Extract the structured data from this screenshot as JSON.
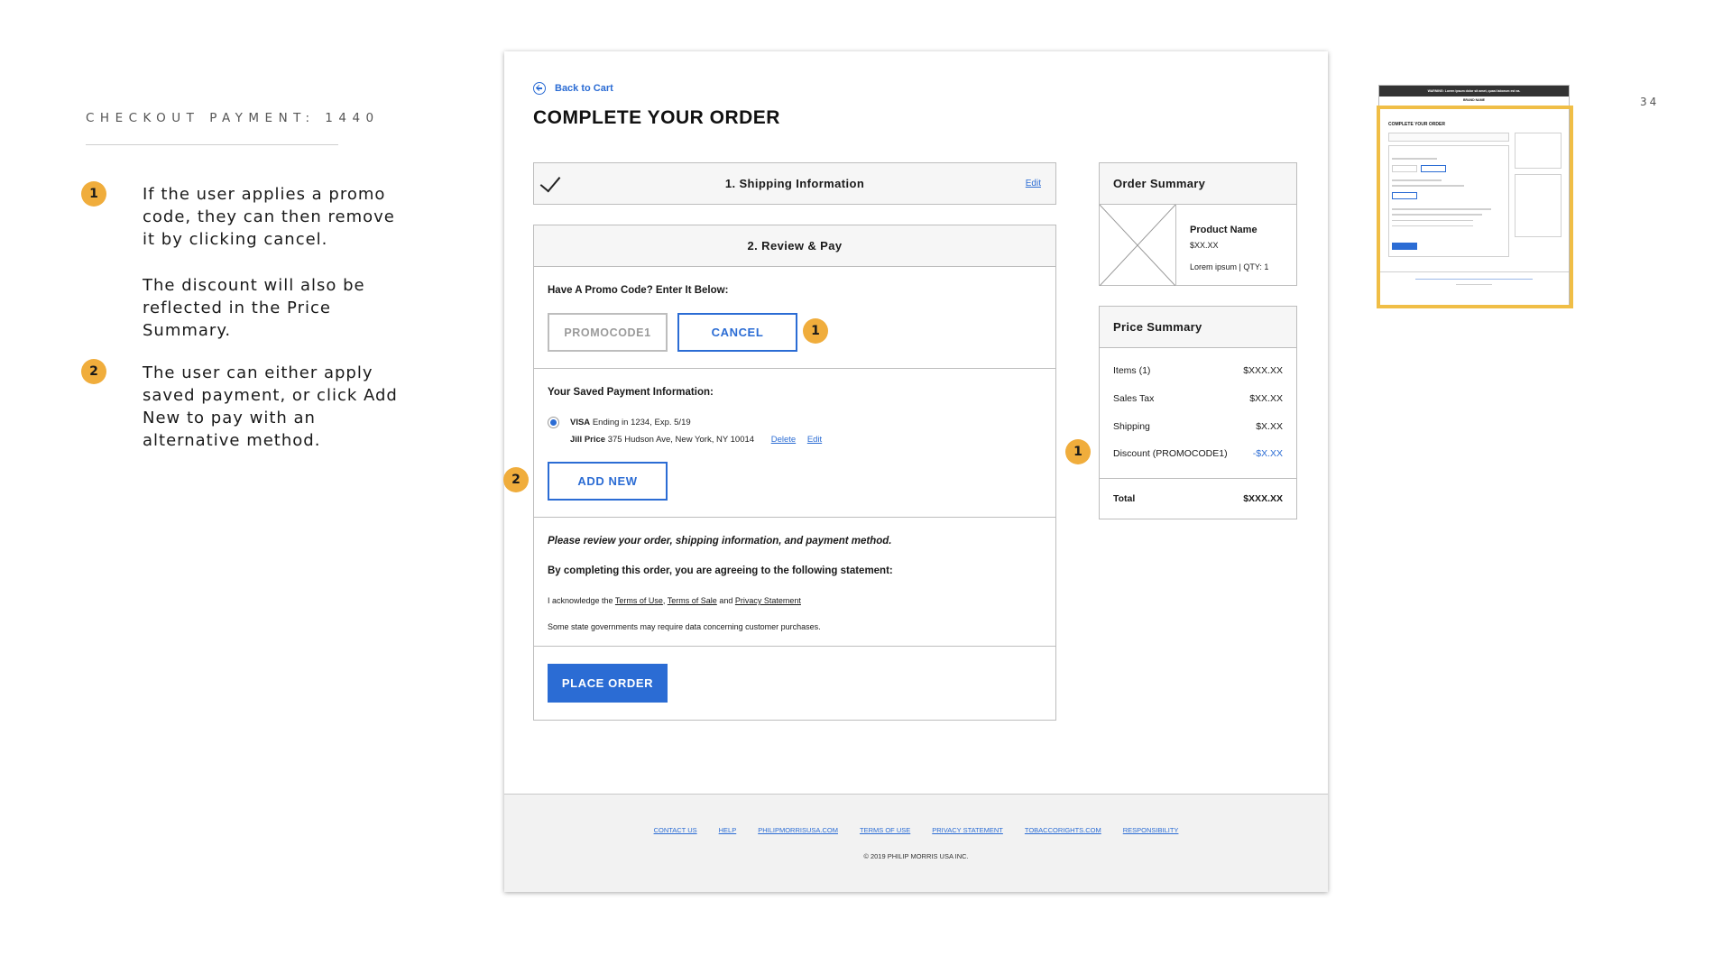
{
  "slide": {
    "title": "CHECKOUT PAYMENT: 1440",
    "page_number": "34",
    "notes": [
      {
        "badge": "1",
        "paragraphs": [
          "If the user applies a promo code, they can then remove it by clicking cancel.",
          "The discount will also be reflected in the Price Summary."
        ]
      },
      {
        "badge": "2",
        "paragraphs": [
          "The user can either apply saved payment, or click Add New to pay with an alternative method."
        ]
      }
    ]
  },
  "page": {
    "back_link": "Back to Cart",
    "title": "COMPLETE YOUR ORDER",
    "shipping": {
      "label": "1. Shipping Information",
      "edit": "Edit"
    },
    "review": {
      "label": "2. Review & Pay",
      "promo_label": "Have A Promo Code? Enter It Below:",
      "promo_value": "PROMOCODE1",
      "cancel": "CANCEL",
      "saved_label": "Your Saved Payment Information:",
      "card_brand": "VISA",
      "card_detail": "Ending in 1234, Exp. 5/19",
      "name": "Jill Price",
      "address": "375 Hudson Ave, New York, NY 10014",
      "delete": "Delete",
      "edit": "Edit",
      "add_new": "ADD NEW",
      "review_note": "Please review your order, shipping information, and payment method.",
      "agree_note": "By completing this order, you are agreeing to the following statement:",
      "ack_prefix": "I acknowledge the",
      "terms_of_use": "Terms of Use",
      "comma": ",",
      "terms_of_sale": "Terms of Sale",
      "and": "and",
      "privacy_statement": "Privacy Statement",
      "state_note": "Some state governments may require data concerning customer purchases.",
      "place_order": "PLACE ORDER"
    },
    "order_summary": {
      "title": "Order Summary",
      "product_name": "Product Name",
      "product_price": "$XX.XX",
      "product_meta": "Lorem ipsum | QTY: 1"
    },
    "price_summary": {
      "title": "Price Summary",
      "rows": [
        {
          "label": "Items (1)",
          "value": "$XXX.XX"
        },
        {
          "label": "Sales Tax",
          "value": "$XX.XX"
        },
        {
          "label": "Shipping",
          "value": "$X.XX"
        },
        {
          "label": "Discount (PROMOCODE1)",
          "value": "-$X.XX"
        }
      ],
      "total_label": "Total",
      "total_value": "$XXX.XX"
    },
    "footer": {
      "links": [
        "CONTACT US",
        "HELP",
        "PHILIPMORRISUSA.COM",
        "TERMS OF USE",
        "PRIVACY STATEMENT",
        "TOBACCORIGHTS.COM",
        "RESPONSIBILITY"
      ],
      "copyright": "© 2019 PHILIP MORRIS USA INC."
    }
  },
  "thumbnail": {
    "warning": "WARNING: Lorem ipsum dolor sit amet, quasi laborum est ea.",
    "brand": "BRAND NAME",
    "title": "COMPLETE YOUR ORDER"
  },
  "colors": {
    "accent": "#2b6cd4",
    "badge": "#f0ad3c",
    "highlight": "#f0be46"
  }
}
